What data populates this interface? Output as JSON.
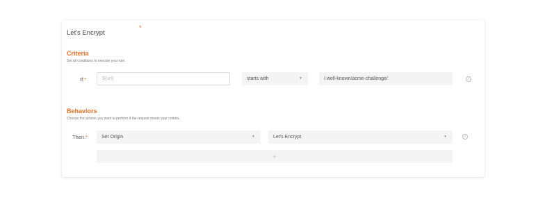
{
  "rule": {
    "name": "Let's Encrypt",
    "required_mark": "*"
  },
  "criteria": {
    "title": "Criteria",
    "description": "Set all conditions to execute your rule.",
    "if_label": "If:",
    "required_mark": "*",
    "variable_placeholder": "${uri}",
    "operator": "starts with",
    "value": "/.well-known/acme-challenge/"
  },
  "behaviors": {
    "title": "Behaviors",
    "description": "Choose the actions you want to perform if the request meets your criteria.",
    "then_label": "Then:",
    "required_mark": "*",
    "behavior": "Set Origin",
    "target": "Let's Encrypt",
    "add_label": "+"
  },
  "icons": {
    "dropdown": "chevron-down-icon",
    "info": "info-icon"
  }
}
